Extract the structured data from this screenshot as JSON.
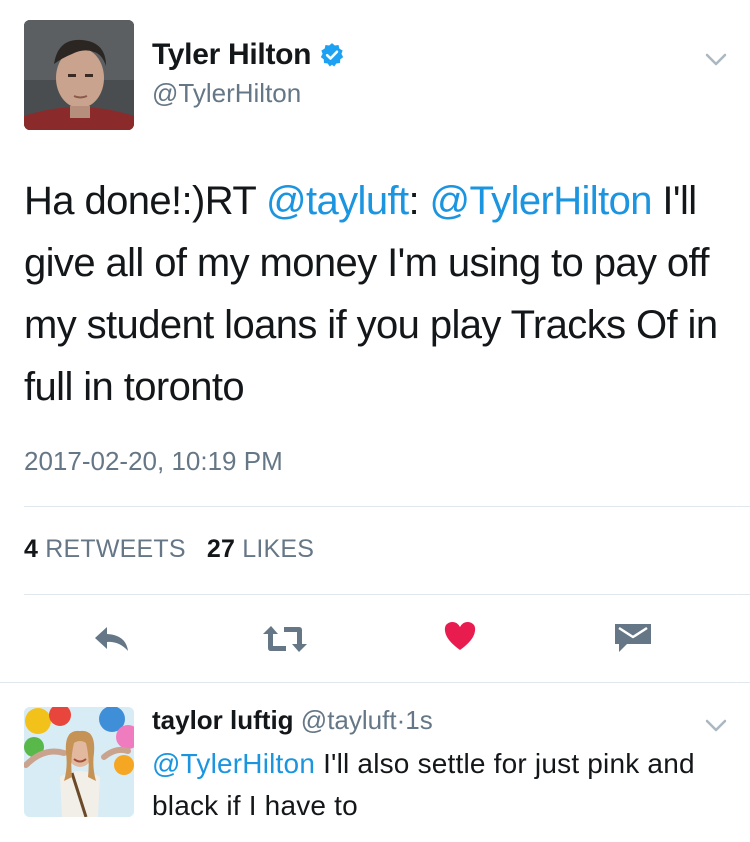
{
  "tweet": {
    "name": "Tyler Hilton",
    "handle": "@TylerHilton",
    "text_prefix": "Ha done!:)RT ",
    "mention1": "@tayluft",
    "text_colon": ": ",
    "mention2": "@TylerHilton",
    "text_body": " I'll give all of my money I'm using to pay off my student loans if you play Tracks Of in full in toronto",
    "timestamp": "2017-02-20, 10:19 PM",
    "retweets_count": "4",
    "retweets_label": "RETWEETS",
    "likes_count": "27",
    "likes_label": "LIKES"
  },
  "reply": {
    "name": "taylor luftig",
    "handle": "@tayluft",
    "separator": "·",
    "time": "1s",
    "mention": "@TylerHilton",
    "text": " I'll also settle for just pink and black if I have to"
  },
  "colors": {
    "link": "#1b95e0",
    "like": "#e81c4f",
    "icon": "#657786",
    "verified": "#1da1f2"
  },
  "icons": {
    "reply": "reply-arrow-icon",
    "retweet": "retweet-icon",
    "like": "heart-icon",
    "dm": "envelope-icon",
    "verified": "verified-badge-icon",
    "menu": "chevron-down-icon"
  }
}
